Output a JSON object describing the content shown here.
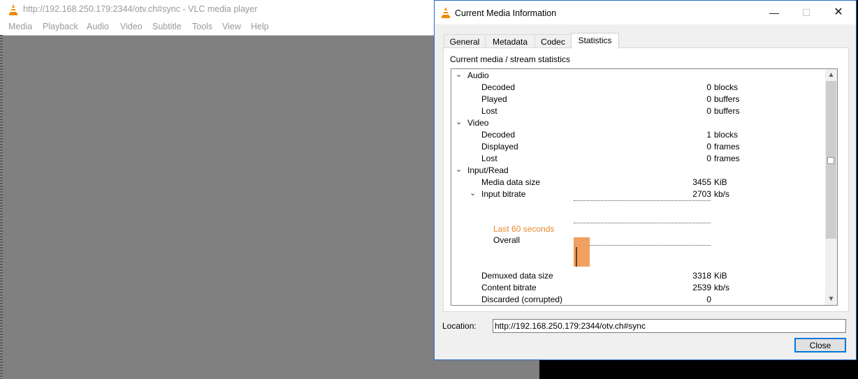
{
  "main_window": {
    "title": "http://192.168.250.179:2344/otv.ch#sync - VLC media player",
    "menu": [
      "Media",
      "Playback",
      "Audio",
      "Video",
      "Subtitle",
      "Tools",
      "View",
      "Help"
    ]
  },
  "dialog": {
    "title": "Current Media Information",
    "controls": {
      "minimize": "—",
      "maximize": "☐",
      "close": "✕"
    },
    "tabs": [
      "General",
      "Metadata",
      "Codec",
      "Statistics"
    ],
    "active_tab": "Statistics",
    "heading": "Current media / stream statistics",
    "stats": {
      "audio": {
        "label": "Audio",
        "decoded": {
          "label": "Decoded",
          "value": "0",
          "unit": "blocks"
        },
        "played": {
          "label": "Played",
          "value": "0",
          "unit": "buffers"
        },
        "lost": {
          "label": "Lost",
          "value": "0",
          "unit": "buffers"
        }
      },
      "video": {
        "label": "Video",
        "decoded": {
          "label": "Decoded",
          "value": "1",
          "unit": "blocks"
        },
        "displayed": {
          "label": "Displayed",
          "value": "0",
          "unit": "frames"
        },
        "lost": {
          "label": "Lost",
          "value": "0",
          "unit": "frames"
        }
      },
      "input": {
        "label": "Input/Read",
        "media_size": {
          "label": "Media data size",
          "value": "3455",
          "unit": "KiB"
        },
        "input_bitrate": {
          "label": "Input bitrate",
          "value": "2703",
          "unit": "kb/s"
        },
        "graph_legend": {
          "last60": "Last 60 seconds",
          "overall": "Overall"
        },
        "demuxed_size": {
          "label": "Demuxed data size",
          "value": "3318",
          "unit": "KiB"
        },
        "content_bitrate": {
          "label": "Content bitrate",
          "value": "2539",
          "unit": "kb/s"
        },
        "discarded": {
          "label": "Discarded (corrupted)",
          "value": "0"
        }
      }
    },
    "location": {
      "label": "Location:",
      "value": "http://192.168.250.179:2344/otv.ch#sync"
    },
    "close_label": "Close"
  },
  "colors": {
    "accent_border": "#2b6cc4",
    "graph_fill": "#f0a060",
    "legend_last60": "#e68a2e",
    "video_area": "#808080"
  }
}
